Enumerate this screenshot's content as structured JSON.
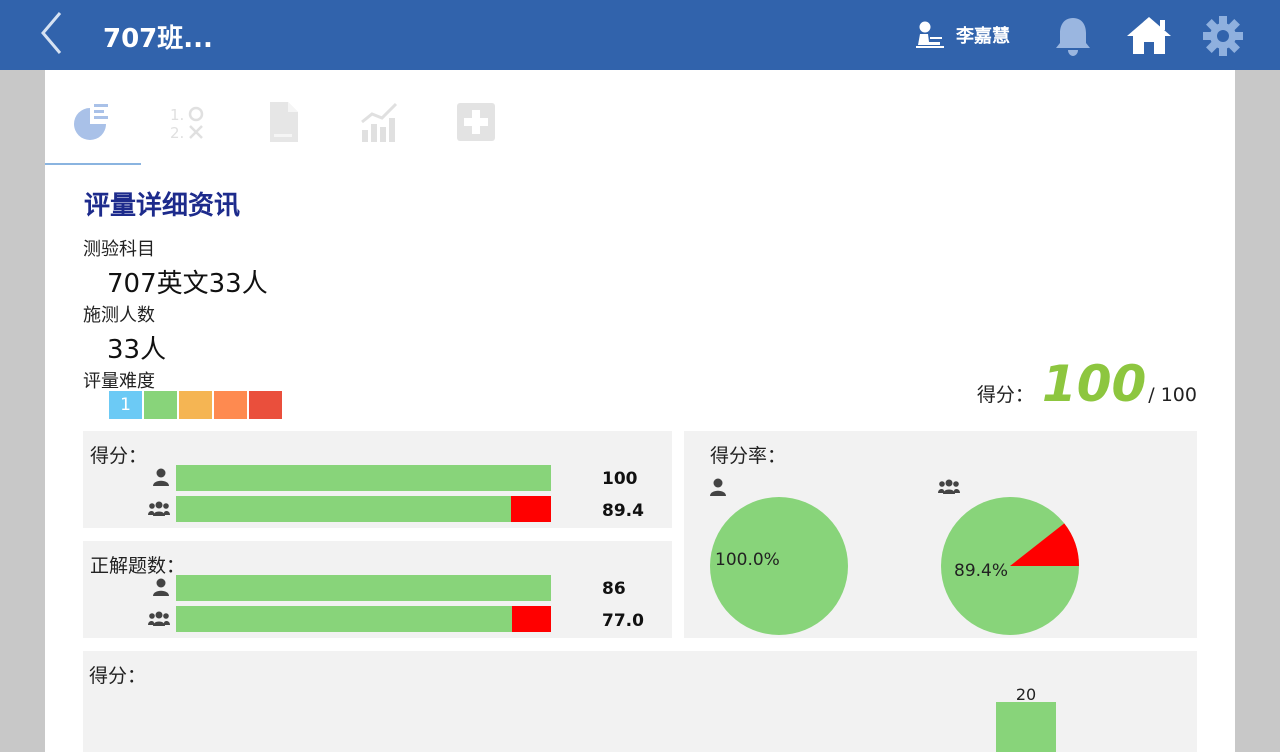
{
  "header": {
    "title": "707班...",
    "user_name": "李嘉慧"
  },
  "tabs": [
    {
      "name": "report-tab",
      "icon": "pie-report-icon",
      "active": true
    },
    {
      "name": "answers-tab",
      "icon": "answer-sheet-icon",
      "active": false
    },
    {
      "name": "document-tab",
      "icon": "document-icon",
      "active": false
    },
    {
      "name": "trend-tab",
      "icon": "trend-chart-icon",
      "active": false
    },
    {
      "name": "add-tab",
      "icon": "plus-icon",
      "active": false
    }
  ],
  "detail": {
    "section_title": "评量详细资讯",
    "subject_label": "测验科目",
    "subject_value": "707英文33人",
    "count_label": "施测人数",
    "count_value": "33人",
    "difficulty_label": "评量难度",
    "difficulty_levels": [
      {
        "text": "1",
        "color": "#6ccaf5"
      },
      {
        "text": "",
        "color": "#88d47a"
      },
      {
        "text": "",
        "color": "#f5b553"
      },
      {
        "text": "",
        "color": "#fe8a50"
      },
      {
        "text": "",
        "color": "#ea4f3c"
      }
    ]
  },
  "score_summary": {
    "label": "得分：",
    "score": "100",
    "max": "/ 100"
  },
  "score_box": {
    "title": "得分：",
    "self_value": "100",
    "class_value": "89.4",
    "self_fraction": 1.0,
    "class_fraction": 0.894
  },
  "correct_box": {
    "title": "正解题数：",
    "self_value": "86",
    "class_value": "77.0",
    "self_fraction": 1.0,
    "class_fraction": 0.895
  },
  "rate_box": {
    "title": "得分率：",
    "self_pct_label": "100.0%",
    "class_pct_label": "89.4%",
    "self_fraction": 1.0,
    "class_fraction": 0.894
  },
  "histogram": {
    "title": "得分：",
    "bar_label": "20"
  },
  "colors": {
    "header_bg": "#3163ac",
    "correct_green": "#88d47a",
    "wrong_red": "#ff0000",
    "score_green": "#8dc63f",
    "title_blue": "#1d2b8c"
  }
}
